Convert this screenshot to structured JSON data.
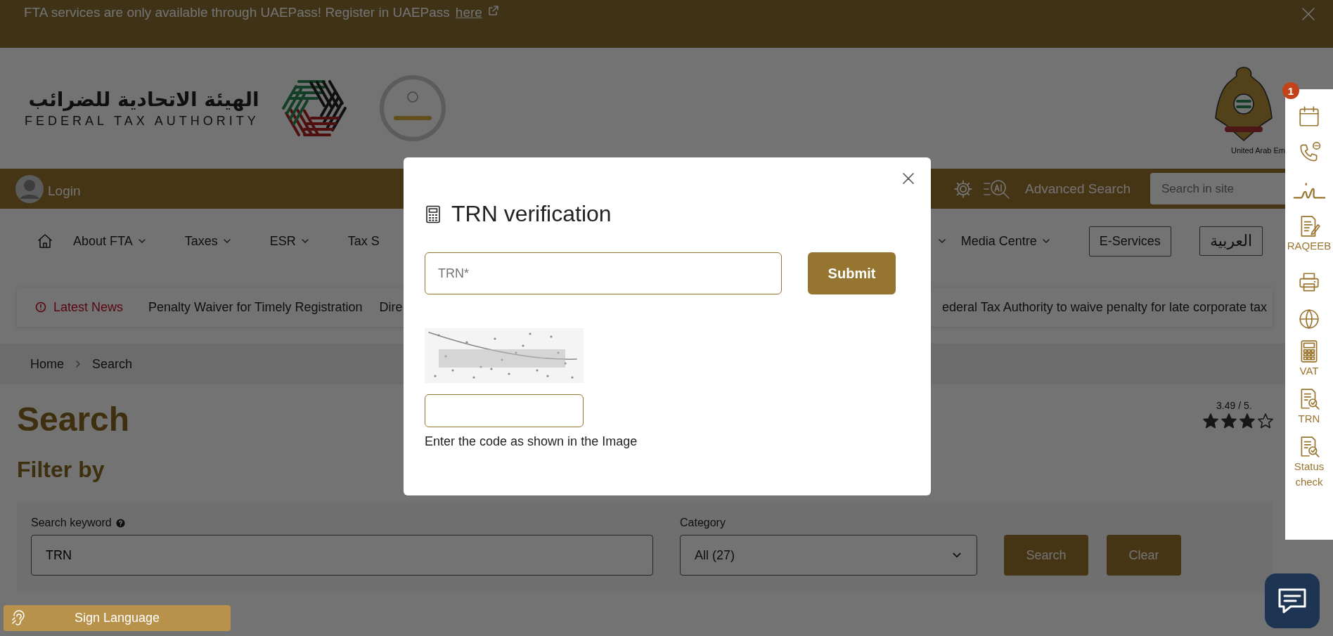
{
  "banner": {
    "text": "FTA services are only available through UAEPass! Register in UAEPass",
    "link": "here"
  },
  "header": {
    "logo_arabic": "الهيئة الاتحادية للضرائب",
    "logo_english": "FEDERAL TAX AUTHORITY",
    "emblem_caption": "United Arab Em"
  },
  "toolbar": {
    "login": "Login",
    "advanced_search": "Advanced Search",
    "search": {
      "placeholder": "Search in site"
    }
  },
  "nav": {
    "left": [
      {
        "label": "About FTA",
        "kind": "dropdown"
      },
      {
        "label": "Taxes",
        "kind": "dropdown"
      },
      {
        "label": "ESR",
        "kind": "dropdown"
      },
      {
        "label": "Tax S",
        "kind": "plain"
      }
    ],
    "right": [
      {
        "label": "Media Centre",
        "kind": "dropdown"
      },
      {
        "label": "E-Services",
        "kind": "outline"
      },
      {
        "label": "العربية",
        "kind": "outline"
      }
    ]
  },
  "news": {
    "label": "Latest News",
    "items": [
      "Penalty Waiver for Timely Registration",
      "Dire",
      "ederal Tax Authority to waive penalty for late corporate tax"
    ]
  },
  "breadcrumb": [
    "Home",
    "Search"
  ],
  "page": {
    "title": "Search",
    "rating": "3.49 / 5.",
    "stars": 3,
    "filter_title": "Filter by"
  },
  "filter": {
    "keyword_label": "Search keyword",
    "keyword_value": "TRN",
    "category_label": "Category",
    "category_value": "All (27)",
    "buttons": [
      "Search",
      "Clear"
    ]
  },
  "modal": {
    "title": "TRN verification",
    "trn": {
      "placeholder": "TRN*"
    },
    "submit": "Submit",
    "captcha_hint": "Enter the code as shown in the Image"
  },
  "sidebar": [
    {
      "kind": "calendar",
      "badge": "1"
    },
    {
      "kind": "phone"
    },
    {
      "kind": "signature"
    },
    {
      "kind": "document",
      "label": "RAQEEB"
    },
    {
      "kind": "printer"
    },
    {
      "kind": "globe"
    },
    {
      "kind": "calculator",
      "label": "VAT"
    },
    {
      "kind": "search-document",
      "label": "TRN"
    },
    {
      "kind": "search-document",
      "label": "Status check"
    }
  ],
  "sign_language": "Sign Language"
}
